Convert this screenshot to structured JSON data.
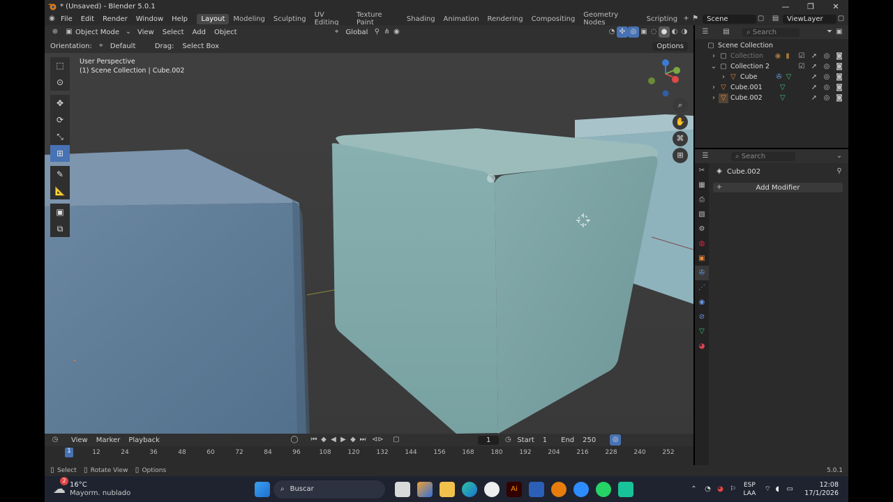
{
  "window": {
    "title": "* (Unsaved) - Blender 5.0.1",
    "controls": [
      "—",
      "❐",
      "✕"
    ]
  },
  "menubar": {
    "menus": [
      "File",
      "Edit",
      "Render",
      "Window",
      "Help"
    ],
    "workspaces": [
      "Layout",
      "Modeling",
      "Sculpting",
      "UV Editing",
      "Texture Paint",
      "Shading",
      "Animation",
      "Rendering",
      "Compositing",
      "Geometry Nodes",
      "Scripting"
    ],
    "active_workspace": "Layout",
    "scene": "Scene",
    "view_layer": "ViewLayer"
  },
  "viewport_header": {
    "mode": "Object Mode",
    "menus": [
      "View",
      "Select",
      "Add",
      "Object"
    ],
    "transform_orientation": "Global"
  },
  "tool_header": {
    "orientation_label": "Orientation:",
    "orientation_value": "Default",
    "drag_label": "Drag:",
    "drag_value": "Select Box",
    "options_label": "Options"
  },
  "viewport": {
    "perspective": "User Perspective",
    "context": "(1) Scene Collection | Cube.002",
    "colors": {
      "background": "#3d3d3d",
      "cube_front": "#7ea6a6",
      "cube_side": "#6b9191",
      "left_cube": "#5f7c96"
    }
  },
  "toolbar_icons": [
    "select-box-icon",
    "cursor-icon",
    "move-icon",
    "rotate-icon",
    "scale-icon",
    "transform-icon",
    "annotate-icon",
    "measure-icon",
    "add-cube-icon",
    "extrude-icon"
  ],
  "outliner": {
    "search_placeholder": "Search",
    "root": "Scene Collection",
    "items": [
      {
        "name": "Collection",
        "level": 1,
        "dim": true
      },
      {
        "name": "Collection 2",
        "level": 1,
        "dim": false
      },
      {
        "name": "Cube",
        "level": 2,
        "dim": false
      },
      {
        "name": "Cube.001",
        "level": 1,
        "dim": false
      },
      {
        "name": "Cube.002",
        "level": 1,
        "dim": false
      }
    ]
  },
  "properties": {
    "search_placeholder": "Search",
    "object_name": "Cube.002",
    "add_modifier_label": "Add Modifier"
  },
  "timeline": {
    "menus": [
      "View",
      "Marker",
      "Playback"
    ],
    "current_frame": "1",
    "start_label": "Start",
    "start_value": "1",
    "end_label": "End",
    "end_value": "250",
    "ticks": [
      "12",
      "24",
      "36",
      "48",
      "60",
      "72",
      "84",
      "96",
      "108",
      "120",
      "132",
      "144",
      "156",
      "168",
      "180",
      "192",
      "204",
      "216",
      "228",
      "240",
      "252"
    ],
    "playhead_label": "1"
  },
  "statusbar": {
    "select": "Select",
    "rotate_view": "Rotate View",
    "options": "Options",
    "version": "5.0.1"
  },
  "taskbar": {
    "weather_temp": "16°C",
    "weather_desc": "Mayorm. nublado",
    "notification_count": "2",
    "search_label": "Buscar",
    "language": "ESP",
    "region": "LAA",
    "time": "12:08",
    "date": "17/1/2026"
  }
}
